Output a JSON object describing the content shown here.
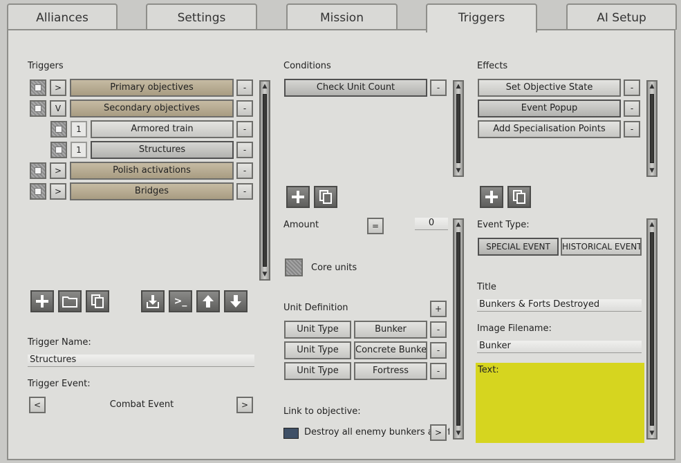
{
  "tabs": [
    "Alliances",
    "Settings",
    "Mission",
    "Triggers",
    "AI Setup"
  ],
  "active_tab": "Triggers",
  "triggers": {
    "title": "Triggers",
    "rows": [
      {
        "toggle": ">",
        "label": "Primary objectives",
        "remove": "-"
      },
      {
        "toggle": "V",
        "label": "Secondary objectives",
        "remove": "-"
      },
      {
        "toggle": "1",
        "label": "Armored train",
        "remove": "-"
      },
      {
        "toggle": "1",
        "label": "Structures",
        "remove": "-"
      },
      {
        "toggle": ">",
        "label": "Polish activations",
        "remove": "-"
      },
      {
        "toggle": ">",
        "label": "Bridges",
        "remove": "-"
      }
    ],
    "name_label": "Trigger Name:",
    "name_value": "Structures",
    "event_label": "Trigger Event:",
    "event_value": "Combat Event",
    "prev": "<",
    "next": ">"
  },
  "conditions": {
    "title": "Conditions",
    "items": [
      "Check Unit Count"
    ],
    "remove": "-",
    "amount_label": "Amount",
    "amount_op": "=",
    "amount_value": "0",
    "core_units_label": "Core units",
    "unit_def_label": "Unit Definition",
    "unit_def_add": "+",
    "unit_defs": [
      {
        "key": "Unit Type",
        "value": "Bunker"
      },
      {
        "key": "Unit Type",
        "value": "Concrete Bunke"
      },
      {
        "key": "Unit Type",
        "value": "Fortress"
      }
    ],
    "link_label": "Link to objective:",
    "link_value": "Destroy all enemy bunkers and fort",
    "link_btn": ">"
  },
  "effects": {
    "title": "Effects",
    "items": [
      "Set Objective State",
      "Event Popup",
      "Add Specialisation Points"
    ],
    "remove": "-",
    "event_type_label": "Event Type:",
    "event_types": [
      "SPECIAL EVENT",
      "HISTORICAL EVENT"
    ],
    "title_label": "Title",
    "title_value": "Bunkers & Forts Destroyed",
    "image_label": "Image Filename:",
    "image_value": "Bunker",
    "text_label": "Text:"
  },
  "colors": {
    "text_highlight": "#d6d51f",
    "tan_button": "#b7ac93",
    "link_color_box": "#3f5066"
  }
}
